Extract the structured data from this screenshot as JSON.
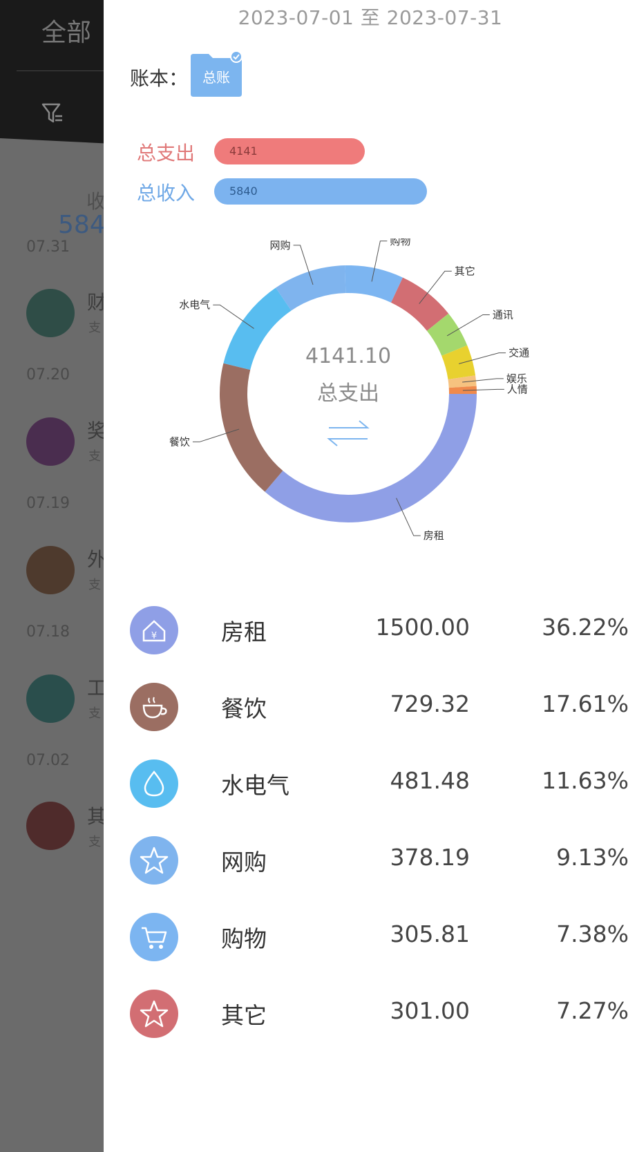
{
  "background": {
    "title": "全部",
    "income_label": "收",
    "income_value": "584",
    "groups": [
      {
        "date": "07.31",
        "name": "财",
        "sub": "支",
        "color": "#2f4d47"
      },
      {
        "date": "07.20",
        "name": "奖",
        "sub": "支",
        "color": "#4a2d4f"
      },
      {
        "date": "07.19",
        "name": "外",
        "sub": "支",
        "color": "#4e3a2d"
      },
      {
        "date": "07.18",
        "name": "工",
        "sub": "支",
        "color": "#2a4e4c"
      },
      {
        "date": "07.02",
        "name": "其",
        "sub": "支",
        "color": "#4f2b2b"
      }
    ]
  },
  "panel": {
    "date_range": "2023-07-01 至 2023-07-31",
    "book_label": "账本：",
    "book_name": "总账",
    "expense_label": "总支出",
    "expense_value": "4141",
    "income_label": "总收入",
    "income_value": "5840",
    "center_total": "4141.10",
    "center_label": "总支出",
    "colors": {
      "expense": "#ef7b7b",
      "income": "#7cb3ef"
    }
  },
  "chart_data": {
    "type": "pie",
    "total": 4141.1,
    "slices": [
      {
        "label": "房租",
        "value": 1500.0,
        "percent": "36.22%",
        "color": "#8f9fe6",
        "icon": "house-icon"
      },
      {
        "label": "餐饮",
        "value": 729.32,
        "percent": "17.61%",
        "color": "#9b6e62",
        "icon": "coffee-cup-icon"
      },
      {
        "label": "水电气",
        "value": 481.48,
        "percent": "11.63%",
        "color": "#58bdf0",
        "icon": "water-drop-icon"
      },
      {
        "label": "网购",
        "value": 378.19,
        "percent": "9.13%",
        "color": "#7fb4ee",
        "icon": "star-icon"
      },
      {
        "label": "购物",
        "value": 305.81,
        "percent": "7.38%",
        "color": "#7cb5f1",
        "icon": "cart-icon"
      },
      {
        "label": "其它",
        "value": 301.0,
        "percent": "7.27%",
        "color": "#d26e73",
        "icon": "star-icon"
      },
      {
        "label": "通讯",
        "value": 190.0,
        "percent": "",
        "color": "#a4d86d",
        "icon": ""
      },
      {
        "label": "交通",
        "value": 160.0,
        "percent": "",
        "color": "#e8d12f",
        "icon": ""
      },
      {
        "label": "娱乐",
        "value": 55.0,
        "percent": "",
        "color": "#f6c27f",
        "icon": ""
      },
      {
        "label": "人情",
        "value": 40.3,
        "percent": "",
        "color": "#f08a4b",
        "icon": ""
      }
    ],
    "list_visible": 6
  }
}
